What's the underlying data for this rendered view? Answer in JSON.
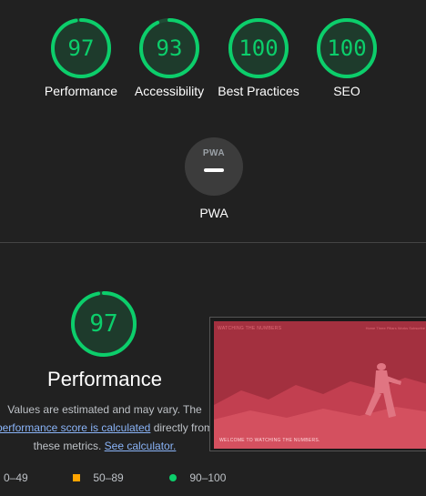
{
  "colors": {
    "pass": "#0cce6b",
    "average": "#ffa400",
    "fail": "#ff4e42",
    "ring_track": "#1f4d36",
    "background": "#212121",
    "link": "#8ab4f8"
  },
  "categories": [
    {
      "label": "Performance",
      "score": 97,
      "icon": "gauge-ring"
    },
    {
      "label": "Accessibility",
      "score": 93,
      "icon": "gauge-ring"
    },
    {
      "label": "Best Practices",
      "score": 100,
      "icon": "gauge-ring"
    },
    {
      "label": "SEO",
      "score": 100,
      "icon": "gauge-ring"
    }
  ],
  "pwa": {
    "badge_text": "PWA",
    "label": "PWA",
    "icon": "pwa-badge-icon"
  },
  "performance_section": {
    "score": 97,
    "title": "Performance",
    "desc_part1": "Values are estimated and may vary. The",
    "desc_link1": "performance score is calculated",
    "desc_part2": " directly from",
    "desc_part3": "these metrics. ",
    "desc_link2": "See calculator."
  },
  "thumbnail": {
    "site_title": "WATCHING THE NUMBERS",
    "nav": "Home   Three Pillars   Works   Subscribe",
    "welcome": "WELCOME TO WATCHING THE NUMBERS."
  },
  "legend": {
    "fail_range": "0–49",
    "average_range": "50–89",
    "pass_range": "90–100"
  }
}
